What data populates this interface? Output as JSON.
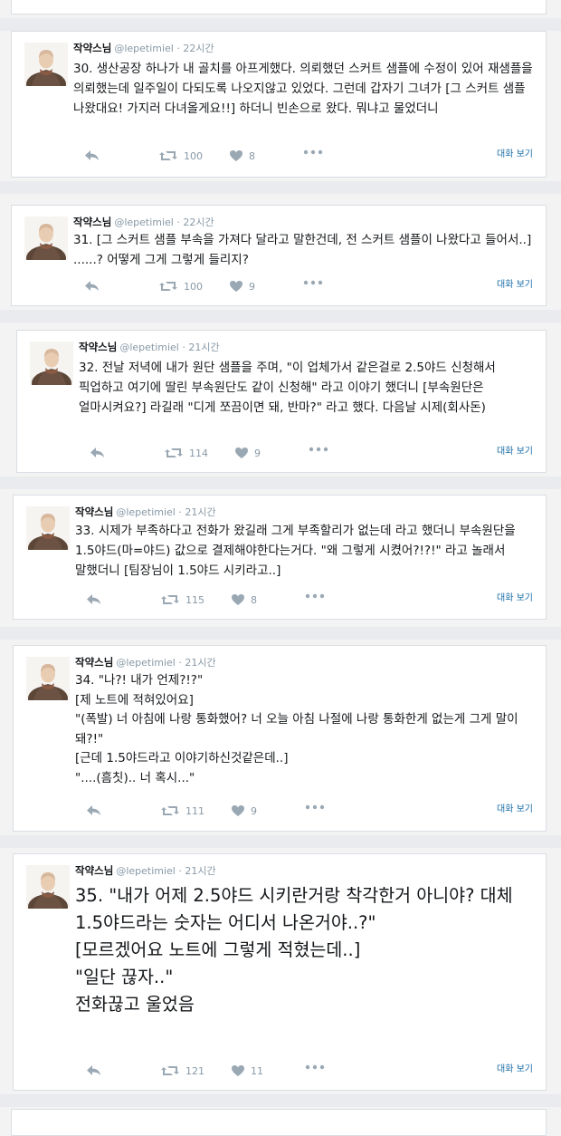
{
  "colors": {
    "background": "#f3f3f3",
    "card": "#ffffff",
    "text": "#14171a",
    "meta": "#8899a6",
    "link": "#1b6fa8"
  },
  "icons": [
    "reply-icon",
    "retweet-icon",
    "heart-icon",
    "more-icon",
    "profile-avatar"
  ],
  "tweets": [
    {
      "name": "작약스님",
      "handle": "@lepetimiel",
      "time": "· 22시간",
      "text": "30. 생산공장 하나가 내 골치를 아프게했다. 의뢰했던 스커트 샘플에 수정이 있어 재샘플을 의뢰했는데 일주일이 다되도록 나오지않고 있었다. 그런데 갑자기 그녀가 [그 스커트 샘플 나왔대요! 가지러 다녀올게요!!] 하더니 빈손으로 왔다. 뭐냐고 물었더니",
      "retweets": "100",
      "likes": "8",
      "conversation": "대화 보기"
    },
    {
      "name": "작약스님",
      "handle": "@lepetimiel",
      "time": "· 22시간",
      "text": "31. [그 스커트 샘플 부속을 가져다 달라고 말한건데, 전 스커트 샘플이 나왔다고 들어서..] ......? 어떻게 그게 그렇게 들리지?",
      "retweets": "100",
      "likes": "9",
      "conversation": "대화 보기"
    },
    {
      "name": "작약스님",
      "handle": "@lepetimiel",
      "time": "· 21시간",
      "text": "32. 전날 저녁에 내가 원단 샘플을 주며, \"이 업체가서 같은걸로 2.5야드 신청해서 픽업하고 여기에 딸린 부속원단도 같이 신청해\" 라고 이야기 했더니 [부속원단은 얼마시켜요?] 라길래 \"디게 쪼끔이면 돼, 반마?\" 라고 했다. 다음날 시제(회사돈)",
      "retweets": "114",
      "likes": "9",
      "conversation": "대화 보기"
    },
    {
      "name": "작약스님",
      "handle": "@lepetimiel",
      "time": "· 21시간",
      "text": "33. 시제가 부족하다고 전화가 왔길래 그게 부족할리가 없는데 라고 했더니 부속원단을 1.5야드(마=야드) 값으로 결제해야한다는거다. \"왜 그렇게 시켰어?!?!\" 라고 놀래서 말했더니 [팀장님이 1.5야드 시키라고..]",
      "retweets": "115",
      "likes": "8",
      "conversation": "대화 보기"
    },
    {
      "name": "작약스님",
      "handle": "@lepetimiel",
      "time": "· 21시간",
      "text": "34. \"나?! 내가 언제?!?\"\n[제 노트에 적혀있어요]\n\"(폭발) 너 아침에 나랑 통화했어? 너 오늘 아침 나절에 나랑 통화한게 없는게 그게 말이 돼?!\"\n[근데 1.5야드라고 이야기하신것같은데..]\n\"....(흠칫).. 너 혹시...\"",
      "retweets": "111",
      "likes": "9",
      "conversation": "대화 보기"
    },
    {
      "name": "작약스님",
      "handle": "@lepetimiel",
      "time": "· 21시간",
      "text": "35. \"내가 어제 2.5야드 시키란거랑 착각한거 아니야? 대체 1.5야드라는 숫자는 어디서 나온거야..?\"\n[모르겠어요 노트에 그렇게 적혔는데..]\n\"일단 끊자..\"\n전화끊고 울었음",
      "retweets": "121",
      "likes": "11",
      "conversation": "대화 보기"
    }
  ]
}
